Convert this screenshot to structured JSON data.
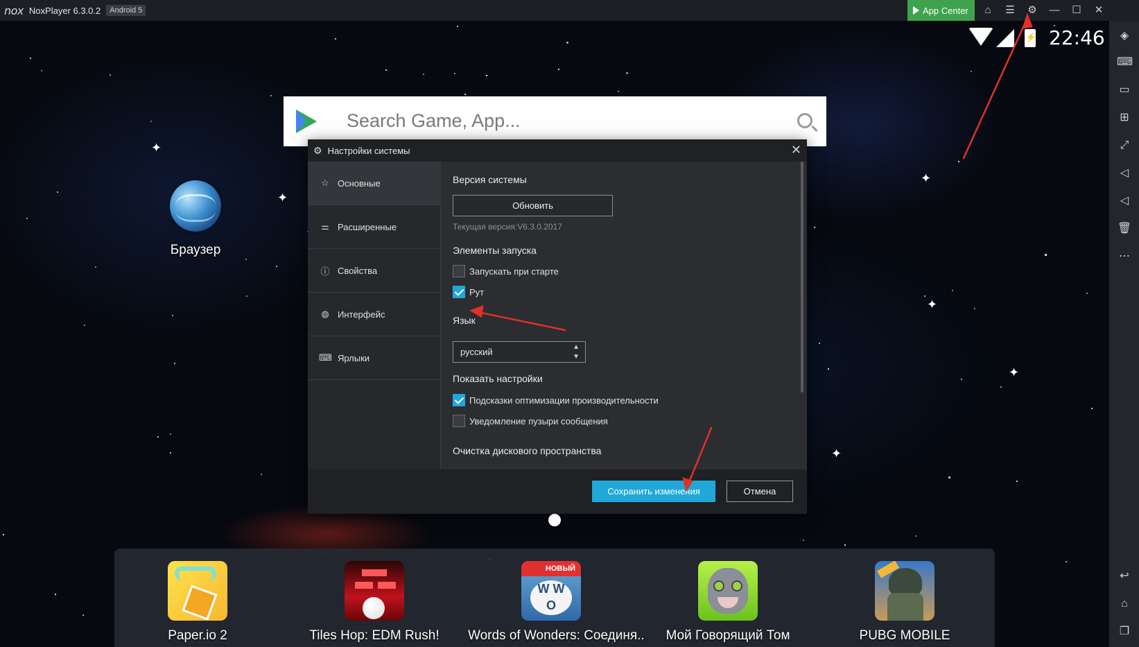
{
  "titlebar": {
    "logo": "nox",
    "title": "NoxPlayer 6.3.0.2",
    "android_badge": "Android 5",
    "app_center": "App Center"
  },
  "status_bar": {
    "time": "22:46"
  },
  "desktop": {
    "browser_label": "Браузер",
    "search_placeholder": "Search Game, App..."
  },
  "dialog": {
    "title": "Настройки системы",
    "sidebar": [
      {
        "label": "Основные",
        "icon": "star-icon"
      },
      {
        "label": "Расширенные",
        "icon": "sliders-icon"
      },
      {
        "label": "Свойства",
        "icon": "info-icon"
      },
      {
        "label": "Интерфейс",
        "icon": "palette-icon"
      },
      {
        "label": "Ярлыки",
        "icon": "keyboard-icon"
      }
    ],
    "system_version": {
      "title": "Версия системы",
      "update_button": "Обновить",
      "current_version": "Текущая версия:V6.3.0.2017"
    },
    "startup": {
      "title": "Элементы запуска",
      "autostart_label": "Запускать при старте",
      "autostart_checked": false,
      "root_label": "Рут",
      "root_checked": true
    },
    "language": {
      "title": "Язык",
      "selected": "русский"
    },
    "show_settings": {
      "title": "Показать настройки",
      "perf_tips_label": "Подсказки оптимизации производительности",
      "perf_tips_checked": true,
      "bubble_label": "Уведомление пузыри сообщения",
      "bubble_checked": false
    },
    "disk_cleanup": {
      "title": "Очистка дискового пространства"
    },
    "save_button": "Сохранить изменения",
    "cancel_button": "Отмена"
  },
  "dock": [
    {
      "label": "Paper.io 2",
      "icon": "paperio-icon"
    },
    {
      "label": "Tiles Hop: EDM Rush!",
      "icon": "tiles-hop-icon"
    },
    {
      "label": "Words of Wonders: Соединя..",
      "icon": "words-of-wonders-icon",
      "badge": "НОВЫЙ"
    },
    {
      "label": "Мой Говорящий Том",
      "icon": "talking-tom-icon"
    },
    {
      "label": "PUBG MOBILE",
      "icon": "pubg-icon"
    }
  ],
  "colors": {
    "accent": "#1fa8d8",
    "app_center": "#3fa34d",
    "annotation": "#e0302a"
  }
}
